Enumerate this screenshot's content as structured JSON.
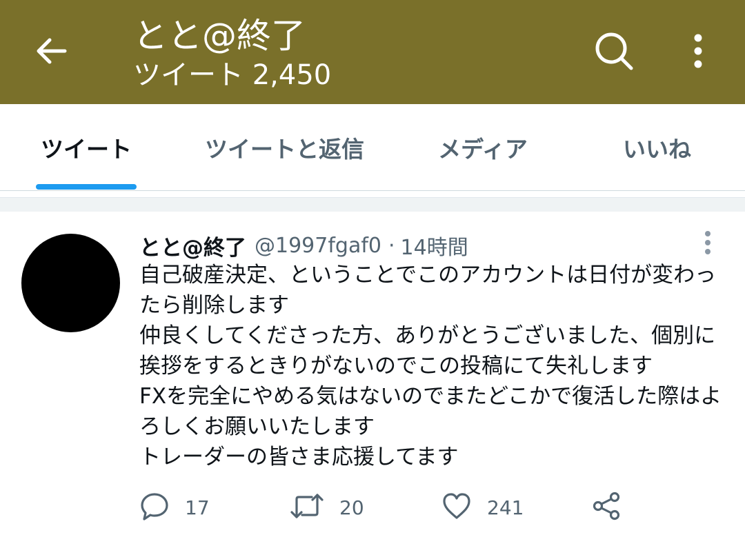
{
  "header": {
    "title": "とと@終了",
    "subtitle": "ツイート 2,450",
    "back_icon": "arrow-left-icon",
    "search_icon": "search-icon",
    "more_icon": "more-vertical-icon",
    "background_color": "#7a702a"
  },
  "tabs": [
    {
      "label": "ツイート",
      "active": true
    },
    {
      "label": "ツイートと返信",
      "active": false
    },
    {
      "label": "メディア",
      "active": false
    },
    {
      "label": "いいね",
      "active": false
    }
  ],
  "accent_color": "#1d9bf0",
  "tweet": {
    "name": "とと@終了",
    "handle": "@1997fgaf0",
    "separator": "·",
    "time": "14時間",
    "lines": [
      "自己破産決定、ということでこのアカウントは日付が変わっ",
      "たら削除します",
      "仲良くしてくださった方、ありがとうございました、個別に",
      "挨拶をするときりがないのでこの投稿にて失礼します",
      "FXを完全にやめる気はないのでまたどこかで復活した際はよ",
      "ろしくお願いいたします",
      "トレーダーの皆さま応援してます"
    ],
    "actions": {
      "reply": {
        "icon": "reply-icon",
        "count": "17"
      },
      "retweet": {
        "icon": "retweet-icon",
        "count": "20"
      },
      "like": {
        "icon": "heart-icon",
        "count": "241"
      },
      "share": {
        "icon": "share-icon"
      }
    }
  }
}
